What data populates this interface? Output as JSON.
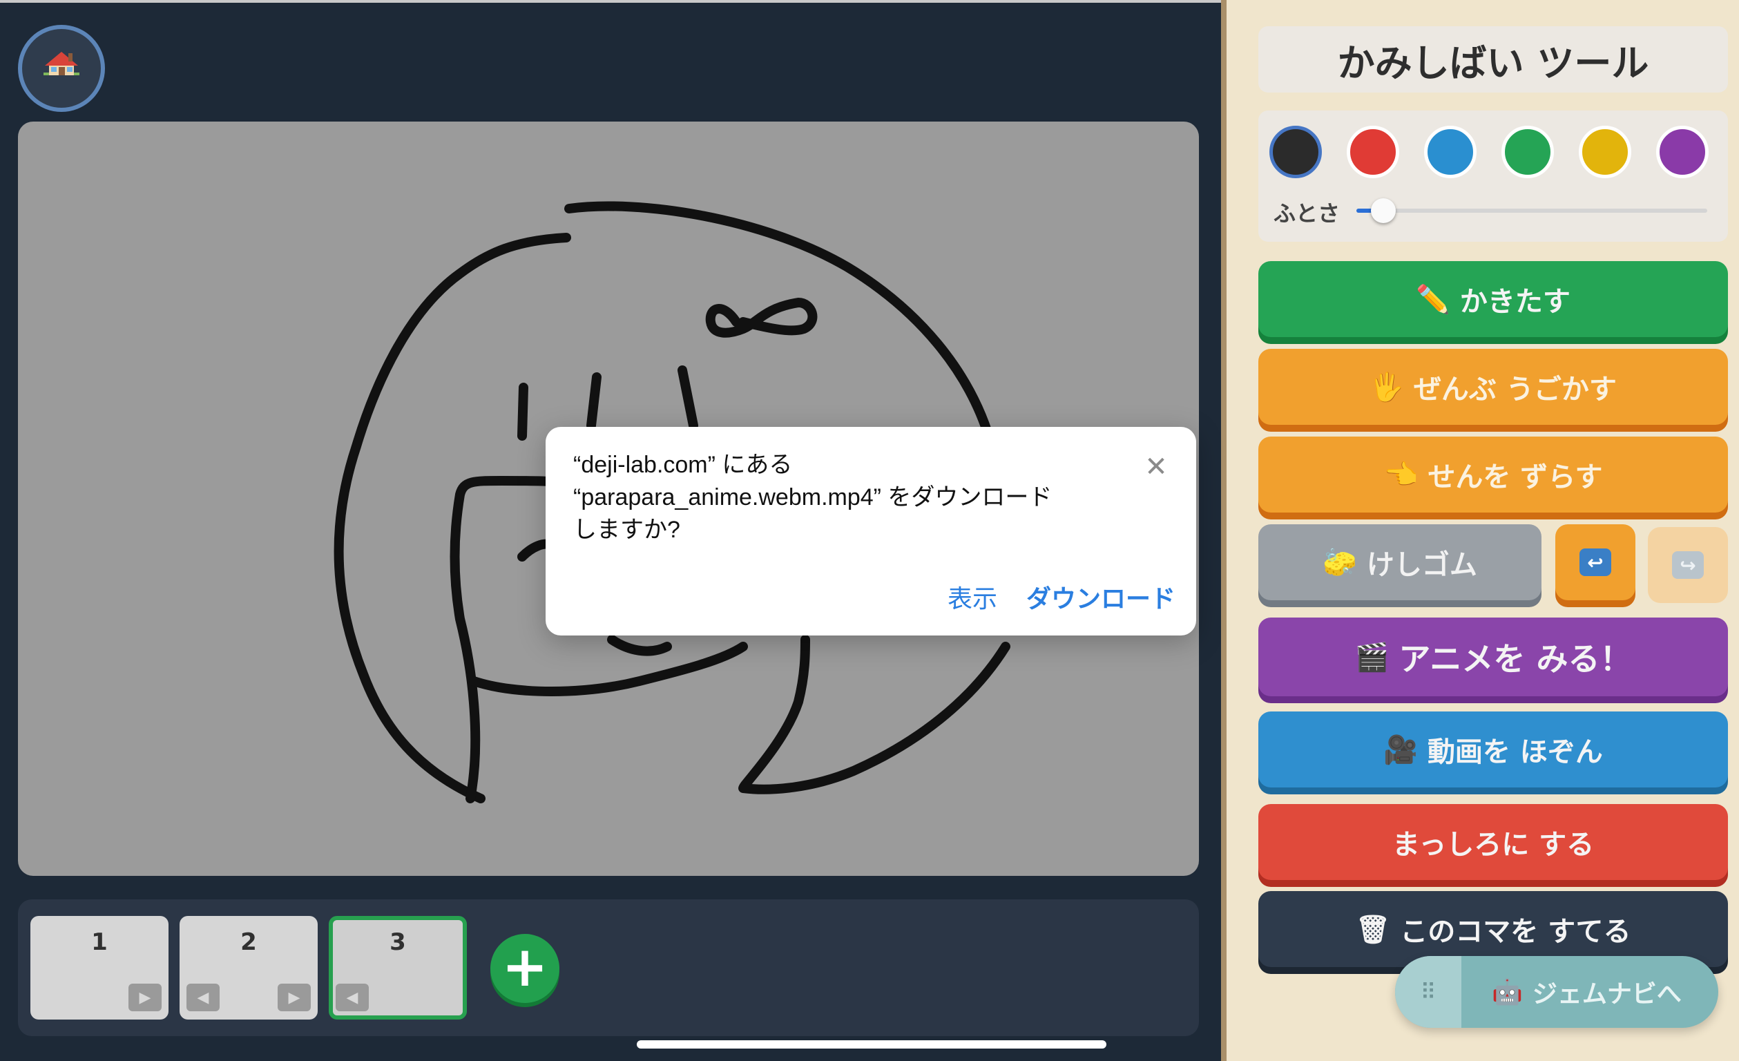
{
  "home": {
    "icon": "house-icon",
    "glyph": "🏠"
  },
  "frames": {
    "items": [
      {
        "number": "1",
        "prev": "",
        "next": "▶"
      },
      {
        "number": "2",
        "prev": "◀",
        "next": "▶"
      },
      {
        "number": "3",
        "prev": "◀",
        "next": ""
      }
    ],
    "active": "3",
    "add_label": "+"
  },
  "panel": {
    "title": "かみしばい ツール",
    "colors": [
      "#2b2b2b",
      "#e03b35",
      "#2a8fd0",
      "#25a455",
      "#e2b40c",
      "#8a3aa8"
    ],
    "selected_color": "#2b2b2b",
    "thickness_label": "ふとさ",
    "thickness_value": 0.05
  },
  "tools": {
    "draw": {
      "icon": "✏️",
      "label": "かきたす"
    },
    "move_all": {
      "icon": "🖐",
      "label": "ぜんぶ うごかす"
    },
    "shift_line": {
      "icon": "👈",
      "label": "せんを ずらす"
    },
    "eraser": {
      "icon": "🧽",
      "label": "けしゴム"
    },
    "undo": {
      "glyph": "↩"
    },
    "redo": {
      "glyph": "↪"
    },
    "watch": {
      "icon": "🎬",
      "label": "アニメを みる！"
    },
    "save_video": {
      "icon": "🎥",
      "label": "動画を ほぞん"
    },
    "clear": {
      "label": "まっしろに する"
    },
    "delete_frame": {
      "icon": "🗑",
      "label": "このコマを すてる"
    }
  },
  "gem_nav": {
    "handle": "⠿",
    "icon": "🤖",
    "label": "ジェムナビへ"
  },
  "dialog": {
    "line1": "“deji-lab.com” にある",
    "line2": "“parapara_anime.webm.mp4” をダウンロード",
    "line3": "しますか?",
    "close": "✕",
    "view_label": "表示",
    "download_label": "ダウンロード"
  }
}
